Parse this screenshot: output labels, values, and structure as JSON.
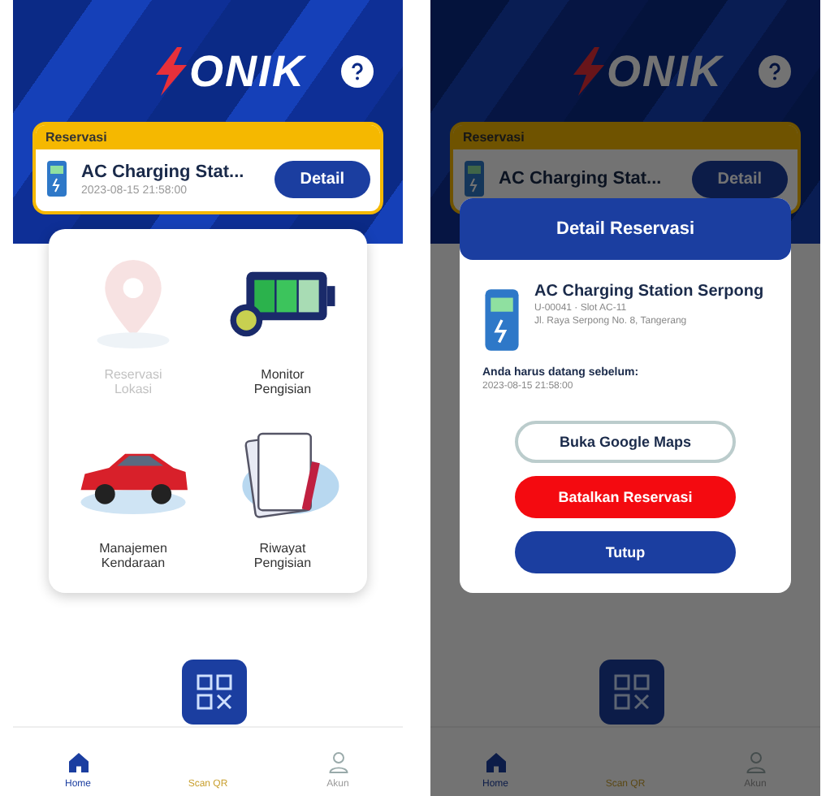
{
  "screens": [
    {
      "header": {
        "logo": "ONIK"
      },
      "reservation": {
        "label": "Reservasi",
        "title": "AC Charging Stat...",
        "time": "2023-08-15 21:58:00",
        "button": "Detail"
      },
      "menu": [
        {
          "kind": "pin",
          "label": "Reservasi Lokasi",
          "disabled": true
        },
        {
          "kind": "battery",
          "label": "Monitor Pengisian",
          "disabled": false
        },
        {
          "kind": "car",
          "label": "Manajemen Kendaraan",
          "disabled": false
        },
        {
          "kind": "papers",
          "label": "Riwayat Pengisian",
          "disabled": false
        }
      ],
      "nav": [
        {
          "kind": "home",
          "label": "Home",
          "selected": true
        },
        {
          "kind": "scan",
          "label": "Scan QR",
          "selected": false
        },
        {
          "kind": "account",
          "label": "Akun",
          "selected": false
        }
      ]
    },
    {
      "header": {
        "logo": "ONIK"
      },
      "reservation": {
        "label": "Reservasi",
        "title": "AC Charging Stat...",
        "button": "Detail"
      },
      "nav": [
        {
          "kind": "home",
          "label": "Home",
          "selected": true
        },
        {
          "kind": "scan",
          "label": "Scan QR",
          "selected": false
        },
        {
          "kind": "account",
          "label": "Akun",
          "selected": false
        }
      ],
      "dialog": {
        "title": "Detail Reservasi",
        "station": "AC Charging Station Serpong",
        "details": [
          "U-00041 · Slot AC-11",
          "Jl. Raya Serpong No. 8, Tangerang"
        ],
        "note": "Anda harus datang sebelum:",
        "deadline": "2023-08-15 21:58:00",
        "buttons": [
          {
            "kind": "outline",
            "label": "Buka Google Maps"
          },
          {
            "kind": "danger",
            "label": "Batalkan Reservasi"
          },
          {
            "kind": "primary",
            "label": "Tutup"
          }
        ]
      }
    }
  ]
}
